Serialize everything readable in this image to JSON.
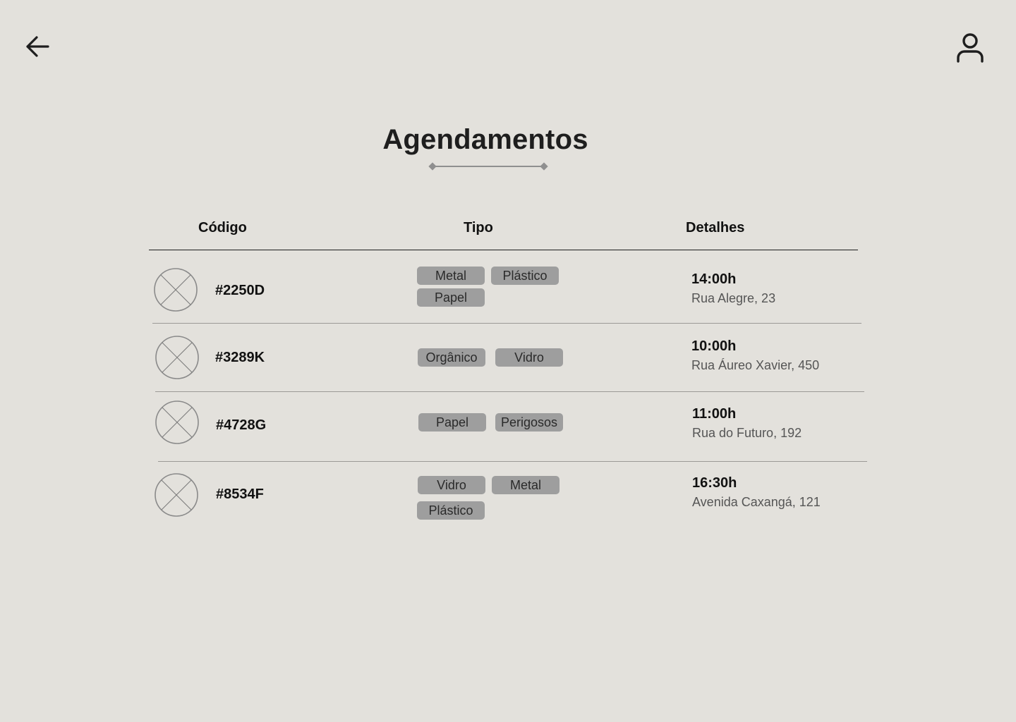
{
  "page": {
    "title": "Agendamentos"
  },
  "nav": {
    "back_icon": "arrow-left-icon",
    "profile_icon": "user-icon"
  },
  "table": {
    "headers": {
      "codigo": "Código",
      "tipo": "Tipo",
      "detalhes": "Detalhes"
    },
    "rows": [
      {
        "code": "#2250D",
        "types": [
          "Metal",
          "Plástico",
          "Papel"
        ],
        "time": "14:00h",
        "address": "Rua Alegre, 23"
      },
      {
        "code": "#3289K",
        "types": [
          "Orgânico",
          "Vidro"
        ],
        "time": "10:00h",
        "address": "Rua Áureo Xavier, 450"
      },
      {
        "code": "#4728G",
        "types": [
          "Papel",
          "Perigosos"
        ],
        "time": "11:00h",
        "address": "Rua do Futuro, 192"
      },
      {
        "code": "#8534F",
        "types": [
          "Vidro",
          "Metal",
          "Plástico"
        ],
        "time": "16:30h",
        "address": "Avenida Caxangá, 121"
      }
    ]
  },
  "colors": {
    "background": "#e3e1dc",
    "chip": "#9e9e9e",
    "text": "#1c1c1c"
  }
}
